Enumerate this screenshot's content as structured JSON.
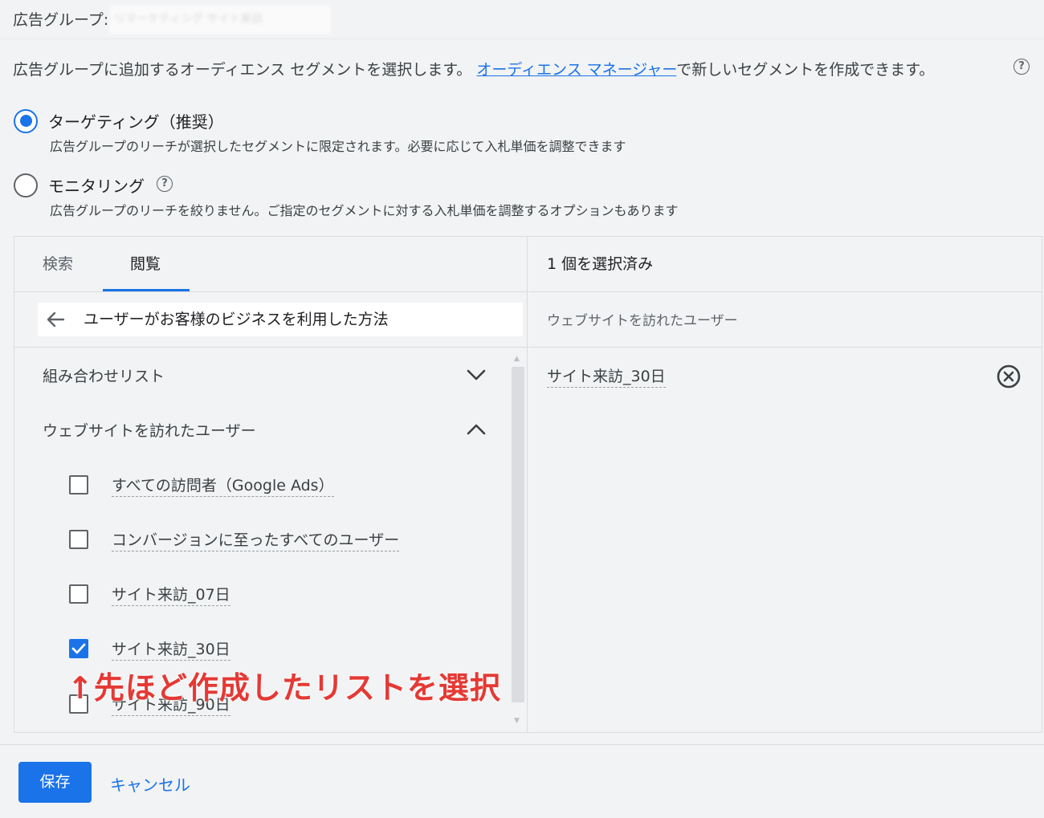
{
  "header": {
    "ad_group_label": "広告グループ:",
    "ad_group_name": "リマーケティング サイト来訪"
  },
  "description": {
    "before_link": "広告グループに追加するオーディエンス セグメントを選択します。",
    "link": "オーディエンス マネージャー",
    "after_link": "で新しいセグメントを作成できます。",
    "help_icon": "help-circle-icon"
  },
  "options": [
    {
      "title": "ターゲティング（推奨）",
      "description": "広告グループのリーチが選択したセグメントに限定されます。必要に応じて入札単価を調整できます",
      "selected": true
    },
    {
      "title": "モニタリング",
      "description": "広告グループのリーチを絞りません。ご指定のセグメントに対する入札単価を調整するオプションもあります",
      "selected": false
    }
  ],
  "browser": {
    "tabs": [
      {
        "label": "検索",
        "active": false
      },
      {
        "label": "閲覧",
        "active": true
      }
    ],
    "breadcrumb": "ユーザーがお客様のビジネスを利用した方法",
    "categories": [
      {
        "title": "組み合わせリスト",
        "expanded": false
      },
      {
        "title": "ウェブサイトを訪れたユーザー",
        "expanded": true
      }
    ],
    "items": [
      {
        "label": "すべての訪問者（Google Ads）",
        "checked": false
      },
      {
        "label": "コンバージョンに至ったすべてのユーザー",
        "checked": false
      },
      {
        "label": "サイト来訪_07日",
        "checked": false
      },
      {
        "label": "サイト来訪_30日",
        "checked": true
      },
      {
        "label": "サイト来訪_90日",
        "checked": false
      }
    ]
  },
  "selected": {
    "count_label": "1 個を選択済み",
    "group": "ウェブサイトを訪れたユーザー",
    "item": "サイト来訪_30日"
  },
  "annotation": "↑先ほど作成したリストを選択",
  "footer": {
    "save": "保存",
    "cancel": "キャンセル"
  },
  "colors": {
    "accent": "#1a73e8",
    "annotation": "#e53935",
    "background": "#f1f3f4"
  }
}
